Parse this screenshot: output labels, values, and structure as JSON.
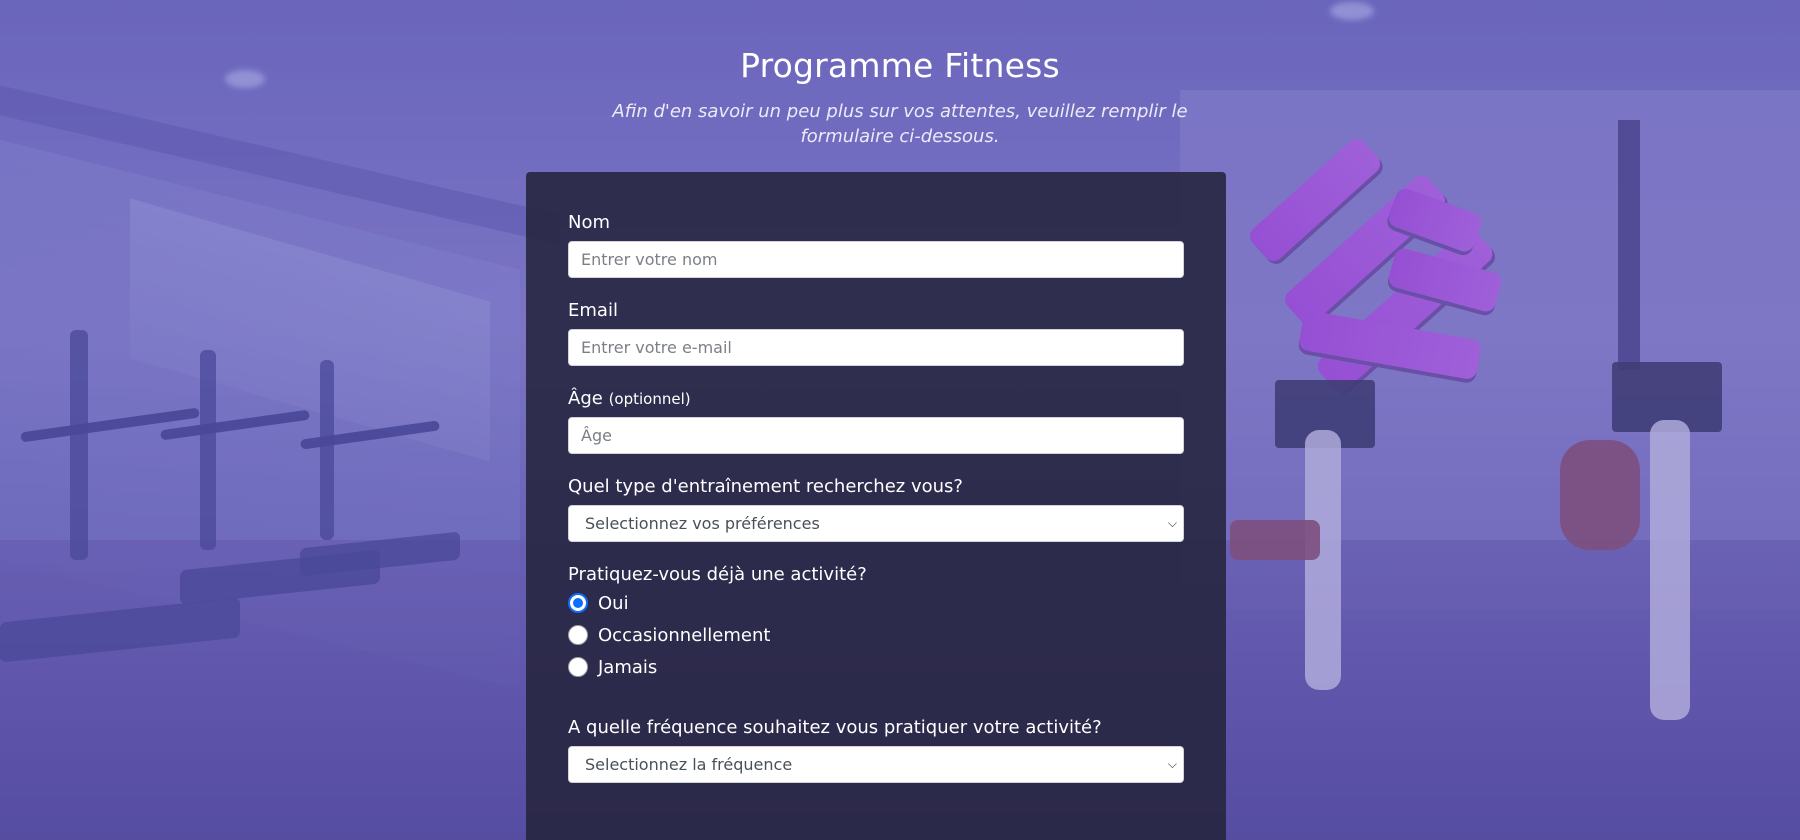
{
  "header": {
    "title": "Programme Fitness",
    "subtitle": "Afin d'en savoir un peu plus sur vos attentes, veuillez remplir le formulaire ci-dessous."
  },
  "form": {
    "name": {
      "label": "Nom",
      "placeholder": "Entrer votre nom"
    },
    "email": {
      "label": "Email",
      "placeholder": "Entrer votre e-mail"
    },
    "age": {
      "label": "Âge",
      "optional": "(optionnel)",
      "placeholder": "Âge"
    },
    "training": {
      "label": "Quel type d'entraînement recherchez vous?",
      "selected": "Selectionnez vos préférences"
    },
    "activity": {
      "label": "Pratiquez-vous déjà une activité?",
      "options": [
        "Oui",
        "Occasionnellement",
        "Jamais"
      ],
      "selected": "Oui"
    },
    "frequency": {
      "label": "A quelle fréquence souhaitez vous pratiquer votre activité?",
      "selected": "Selectionnez la fréquence"
    }
  },
  "colors": {
    "accent": "#0d6efd",
    "card_bg": "#26243e",
    "overlay": "#6258be",
    "logo_purple": "#b24be0"
  },
  "icons": {
    "select_arrow": "chevron-down-icon"
  }
}
